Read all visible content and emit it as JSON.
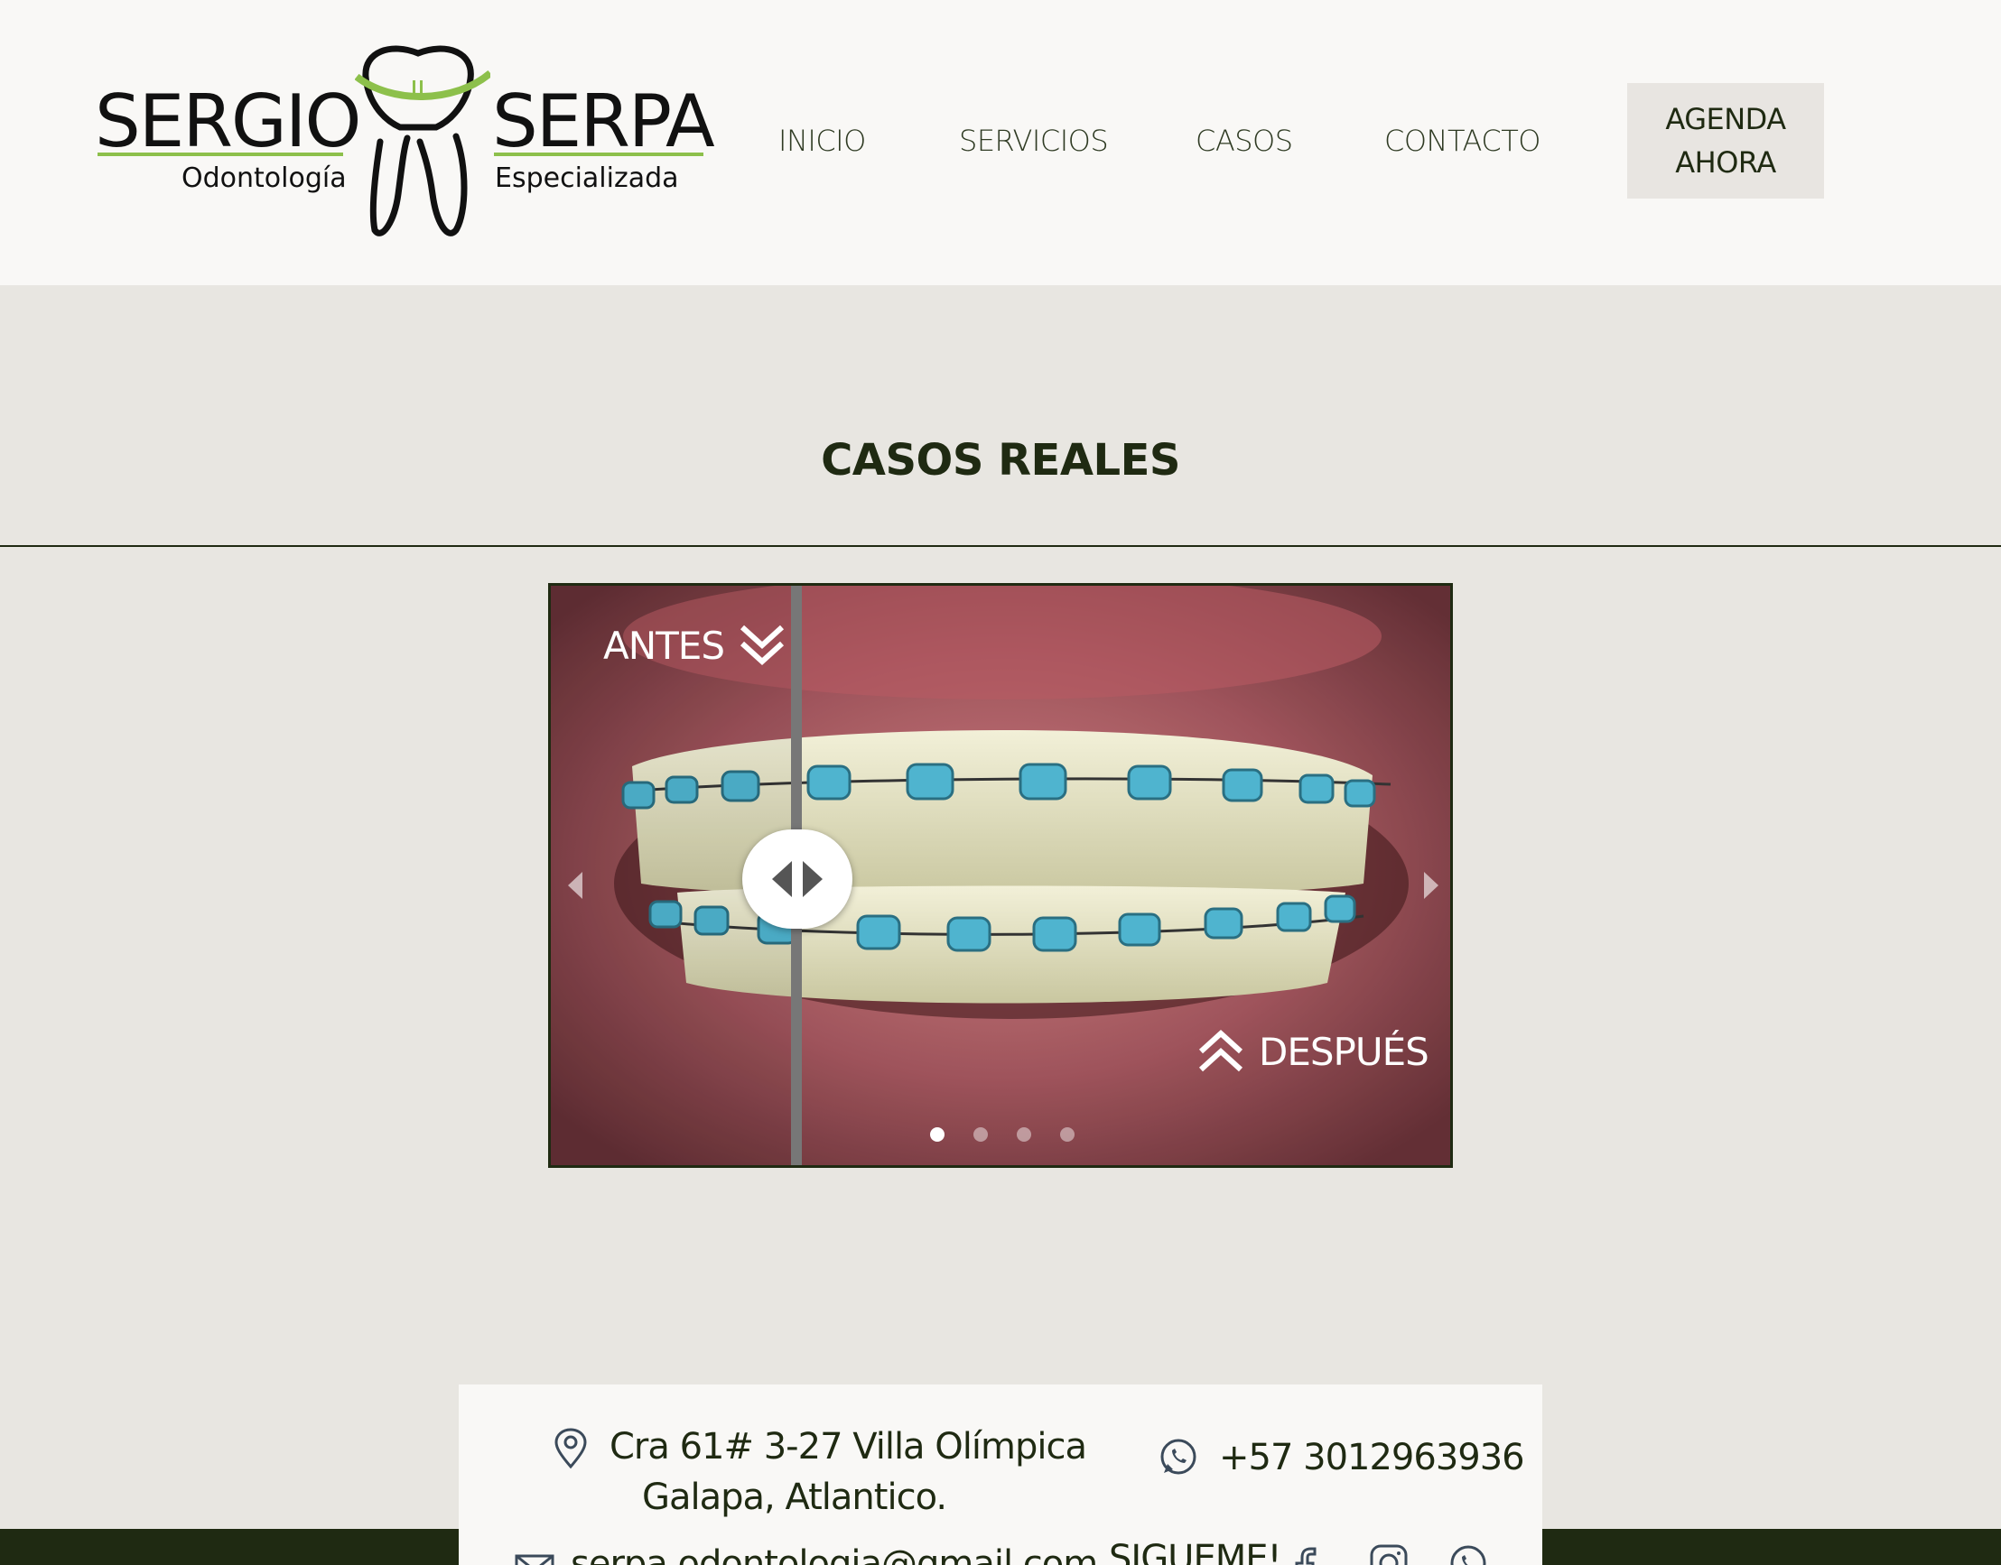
{
  "header": {
    "logo": {
      "name_left": "SERGIO",
      "name_right": "SERPA",
      "sub_left": "Odontología",
      "sub_right": "Especializada",
      "accent_color": "#8dc04b"
    },
    "nav": [
      {
        "label": "INICIO"
      },
      {
        "label": "SERVICIOS"
      },
      {
        "label": "CASOS"
      },
      {
        "label": "CONTACTO"
      }
    ],
    "cta": {
      "line1": "AGENDA",
      "line2": "AHORA"
    }
  },
  "section": {
    "title": "CASOS REALES"
  },
  "slider": {
    "label_before": "ANTES",
    "label_after": "DESPUÉS",
    "slides_total": 4,
    "active_slide": 1,
    "comparison_split": 0.27
  },
  "contact": {
    "address_line1": "Cra 61# 3-27 Villa Olímpica",
    "address_line2": "Galapa, Atlantico.",
    "phone": "+57 3012963936",
    "email": "serpa.odontologia@gmail.com",
    "follow_label": "SIGUEME!"
  },
  "colors": {
    "background": "#e8e6e1",
    "header_bg": "#f9f8f6",
    "text_dark": "#1f2a12",
    "footer": "#1f2a12"
  }
}
